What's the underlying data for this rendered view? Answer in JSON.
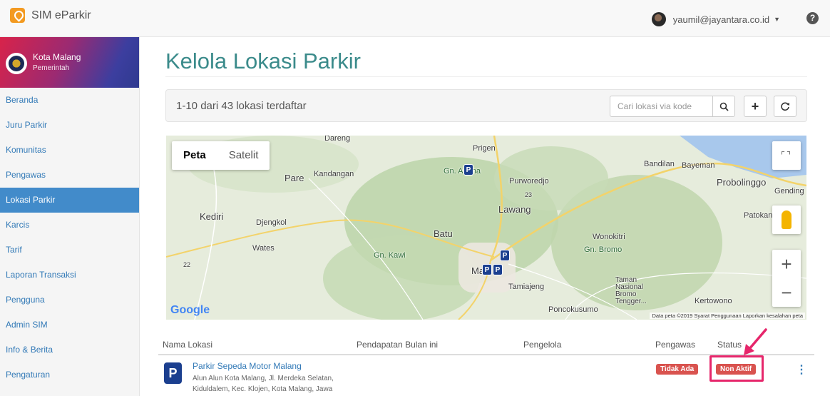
{
  "app": {
    "name": "SIM eParkir"
  },
  "user": {
    "email": "yaumil@jayantara.co.id"
  },
  "sidebar": {
    "org_name": "Kota Malang",
    "org_sub": "Pemerintah",
    "items": [
      {
        "label": "Beranda"
      },
      {
        "label": "Juru Parkir"
      },
      {
        "label": "Komunitas"
      },
      {
        "label": "Pengawas"
      },
      {
        "label": "Lokasi Parkir"
      },
      {
        "label": "Karcis"
      },
      {
        "label": "Tarif"
      },
      {
        "label": "Laporan Transaksi"
      },
      {
        "label": "Pengguna"
      },
      {
        "label": "Admin SIM"
      },
      {
        "label": "Info & Berita"
      },
      {
        "label": "Pengaturan"
      }
    ]
  },
  "main": {
    "title": "Kelola Lokasi Parkir",
    "count_text": "1-10 dari 43 lokasi terdaftar",
    "search_placeholder": "Cari lokasi via kode"
  },
  "map": {
    "type_map": "Peta",
    "type_satellite": "Satelit",
    "logo": "Google",
    "attribution": "Data peta ©2019   Syarat Penggunaan   Laporkan kesalahan peta",
    "places": {
      "p1": "Dareng",
      "p2": "Prigen",
      "p3": "Gn. Arjuna",
      "p4": "Bandilan",
      "p5": "Bayeman",
      "p6": "Kandangan",
      "p7": "Pare",
      "p8": "Purworedjo",
      "p9": "Probolinggo",
      "p10": "Gending",
      "p11": "Lawang",
      "p12": "Kediri",
      "p13": "Djengkol",
      "p14": "Patokan",
      "p15": "Batu",
      "p16": "Wonokitri",
      "p17": "Wates",
      "p18": "Gn. Kawi",
      "p19": "Gn. Bromo",
      "p20": "Ma",
      "p21": "Tamiajeng",
      "p22": "Taman Nasional Bromo Tengger...",
      "p23": "Kertowono",
      "p24": "Poncokusumo",
      "r1": "22",
      "r2": "23"
    }
  },
  "table": {
    "headers": {
      "name": "Nama Lokasi",
      "income": "Pendapatan Bulan ini",
      "manager": "Pengelola",
      "supervisor": "Pengawas",
      "status": "Status"
    },
    "rows": [
      {
        "name": "Parkir Sepeda Motor Malang",
        "address": "Alun Alun Kota Malang, Jl. Merdeka Selatan, Kiduldalem, Kec. Klojen, Kota Malang, Jawa",
        "supervisor": "Tidak Ada",
        "status": "Non Aktif",
        "icon_letter": "P"
      }
    ]
  },
  "colors": {
    "accent": "#428bca",
    "title": "#3b8b8b",
    "danger": "#d9534f",
    "highlight": "#e6266b"
  },
  "icons": [
    "pin-logo-icon",
    "caret-down-icon",
    "help-icon",
    "search-icon",
    "plus-icon",
    "refresh-icon",
    "fullscreen-icon",
    "pegman-icon",
    "zoom-in-icon",
    "zoom-out-icon",
    "parking-icon",
    "kebab-menu-icon",
    "arrow-annotation-icon"
  ]
}
